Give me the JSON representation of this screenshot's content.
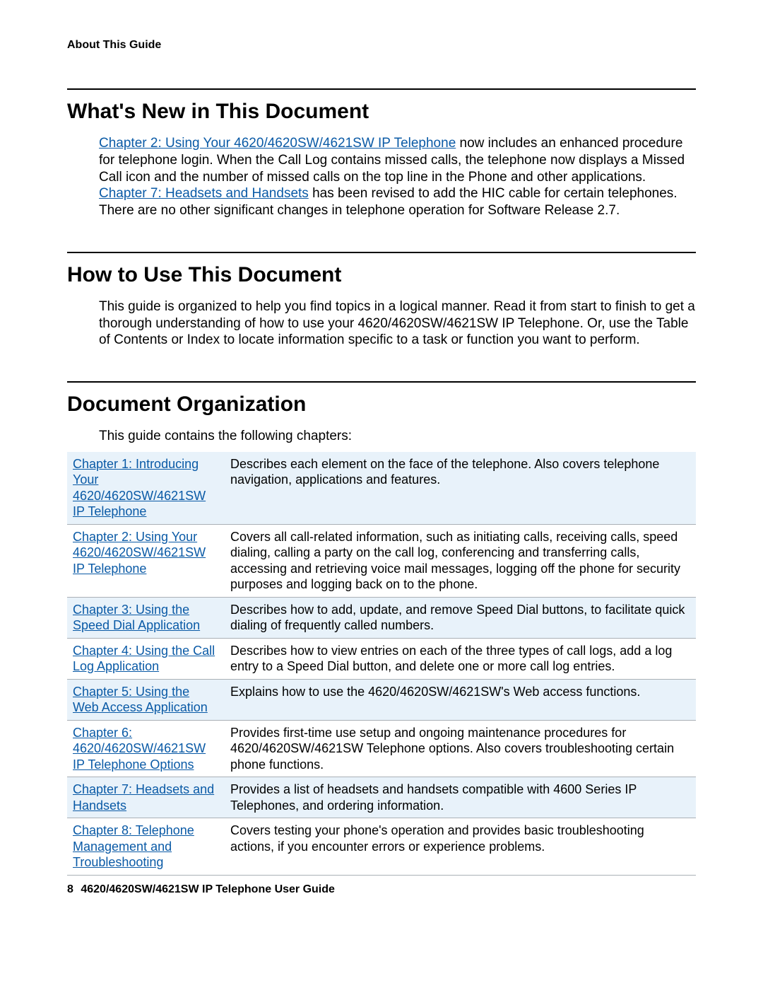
{
  "header": {
    "running": "About This Guide"
  },
  "sections": {
    "whats_new": {
      "title": "What's New in This Document",
      "link1": "Chapter 2: Using Your 4620/4620SW/4621SW IP Telephone",
      "run1": " now includes an enhanced procedure for telephone login. When the Call Log contains missed calls, the telephone now displays a Missed Call icon and the number of missed calls on the top line in the Phone and other applications. ",
      "link2": "Chapter 7: Headsets and Handsets",
      "run2": " has been revised to add the HIC cable for certain telephones. There are no other significant changes in telephone operation for Software Release 2.7."
    },
    "how_to": {
      "title": "How to Use This Document",
      "body": "This guide is organized to help you find topics in a logical manner. Read it from start to finish to get a thorough understanding of how to use your 4620/4620SW/4621SW IP Telephone. Or, use the Table of Contents or Index to locate information specific to a task or function you want to perform."
    },
    "org": {
      "title": "Document Organization",
      "intro": "This guide contains the following chapters:",
      "rows": [
        {
          "shade": true,
          "link": "Chapter 1: Introducing Your 4620/4620SW/4621SW IP Telephone",
          "desc": "Describes each element on the face of the telephone. Also covers telephone navigation, applications and features."
        },
        {
          "shade": false,
          "link": "Chapter 2: Using Your 4620/4620SW/4621SW IP Telephone",
          "desc": "Covers all call-related information, such as initiating calls, receiving calls, speed dialing, calling a party on the call log, conferencing and transferring calls, accessing and retrieving voice mail messages, logging off the phone for security purposes and logging back on to the phone."
        },
        {
          "shade": true,
          "link": "Chapter 3: Using the Speed Dial Application",
          "desc": "Describes how to add, update, and remove Speed Dial buttons, to facilitate quick dialing of frequently called numbers."
        },
        {
          "shade": false,
          "link": "Chapter 4: Using the Call Log Application",
          "desc": "Describes how to view entries on each of the three types of call logs, add a log entry to a Speed Dial button, and delete one or more call log entries."
        },
        {
          "shade": true,
          "link": "Chapter 5: Using the Web Access Application",
          "desc": "Explains how to use the 4620/4620SW/4621SW's Web access functions."
        },
        {
          "shade": false,
          "link": "Chapter 6: 4620/4620SW/4621SW IP Telephone Options",
          "desc": "Provides first-time use setup and ongoing maintenance procedures for 4620/4620SW/4621SW Telephone options. Also covers troubleshooting certain phone functions."
        },
        {
          "shade": true,
          "link": "Chapter 7: Headsets and Handsets",
          "desc": "Provides a list of headsets and handsets compatible with 4600 Series IP Telephones, and ordering information."
        },
        {
          "shade": false,
          "link": "Chapter 8: Telephone Management and Troubleshooting",
          "desc": "Covers testing your phone's operation and provides basic troubleshooting actions, if you encounter errors or experience problems."
        }
      ]
    }
  },
  "footer": {
    "page": "8",
    "title": "4620/4620SW/4621SW IP Telephone User Guide"
  }
}
